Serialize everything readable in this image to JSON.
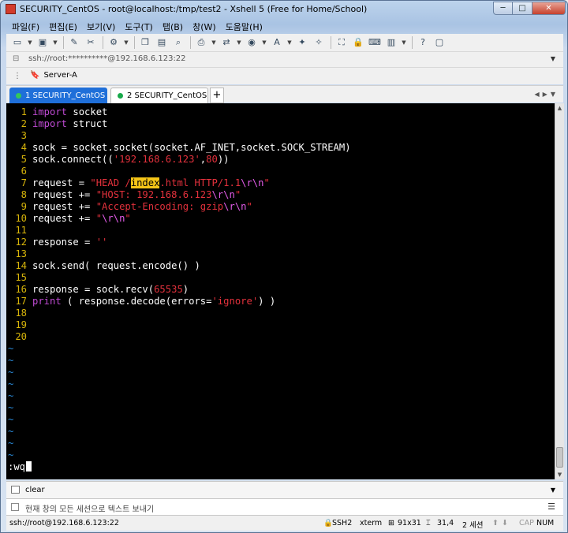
{
  "window": {
    "title": "SECURITY_CentOS - root@localhost:/tmp/test2 - Xshell 5 (Free for Home/School)",
    "minimize": "─",
    "maximize": "□",
    "close": "✕"
  },
  "menu": [
    "파일(F)",
    "편집(E)",
    "보기(V)",
    "도구(T)",
    "탭(B)",
    "창(W)",
    "도움말(H)"
  ],
  "toolbar_icons": [
    "new-session-icon",
    "open-folder-icon",
    "reconnect-icon",
    "disconnect-icon",
    "properties-icon",
    "copy-icon",
    "paste-icon",
    "find-icon",
    "print-icon",
    "transfer-icon",
    "globe-icon",
    "font-icon",
    "xftp-icon",
    "xmanager-icon",
    "fullscreen-icon",
    "lock-icon",
    "keyboard-icon",
    "script-icon",
    "help-icon",
    "chat-icon"
  ],
  "address": {
    "value": "ssh://root:**********@192.168.6.123:22"
  },
  "links": {
    "server": "Server-A"
  },
  "tabs": [
    {
      "label": "1 SECURITY_CentOS",
      "active": true
    },
    {
      "label": "2 SECURITY_CentOS",
      "active": false
    }
  ],
  "tab_add": "+",
  "terminal": {
    "lines": [
      {
        "n": "1",
        "segments": [
          {
            "t": "import",
            "c": "kw"
          },
          {
            "t": " socket",
            "c": ""
          }
        ]
      },
      {
        "n": "2",
        "segments": [
          {
            "t": "import",
            "c": "kw"
          },
          {
            "t": " struct",
            "c": ""
          }
        ]
      },
      {
        "n": "3",
        "segments": []
      },
      {
        "n": "4",
        "segments": [
          {
            "t": "sock = socket.socket(socket.AF_INET,socket.SOCK_STREAM)",
            "c": ""
          }
        ]
      },
      {
        "n": "5",
        "segments": [
          {
            "t": "sock.connect((",
            "c": ""
          },
          {
            "t": "'192.168.6.123'",
            "c": "str"
          },
          {
            "t": ",",
            "c": ""
          },
          {
            "t": "80",
            "c": "str"
          },
          {
            "t": "))",
            "c": ""
          }
        ]
      },
      {
        "n": "6",
        "segments": []
      },
      {
        "n": "7",
        "segments": [
          {
            "t": "request = ",
            "c": ""
          },
          {
            "t": "\"HEAD /",
            "c": "str"
          },
          {
            "t": "index",
            "c": "hl"
          },
          {
            "t": ".html HTTP/1.1",
            "c": "str"
          },
          {
            "t": "\\r\\n",
            "c": "esc"
          },
          {
            "t": "\"",
            "c": "str"
          }
        ]
      },
      {
        "n": "8",
        "segments": [
          {
            "t": "request += ",
            "c": ""
          },
          {
            "t": "\"HOST: 192.168.6.123",
            "c": "str"
          },
          {
            "t": "\\r\\n",
            "c": "esc"
          },
          {
            "t": "\"",
            "c": "str"
          }
        ]
      },
      {
        "n": "9",
        "segments": [
          {
            "t": "request += ",
            "c": ""
          },
          {
            "t": "\"Accept-Encoding: gzip",
            "c": "str"
          },
          {
            "t": "\\r\\n",
            "c": "esc"
          },
          {
            "t": "\"",
            "c": "str"
          }
        ]
      },
      {
        "n": "10",
        "segments": [
          {
            "t": "request += ",
            "c": ""
          },
          {
            "t": "\"",
            "c": "str"
          },
          {
            "t": "\\r\\n",
            "c": "esc"
          },
          {
            "t": "\"",
            "c": "str"
          }
        ]
      },
      {
        "n": "11",
        "segments": []
      },
      {
        "n": "12",
        "segments": [
          {
            "t": "response = ",
            "c": ""
          },
          {
            "t": "''",
            "c": "str"
          }
        ]
      },
      {
        "n": "13",
        "segments": []
      },
      {
        "n": "14",
        "segments": [
          {
            "t": "sock.send( request.encode() )",
            "c": ""
          }
        ]
      },
      {
        "n": "15",
        "segments": []
      },
      {
        "n": "16",
        "segments": [
          {
            "t": "response = sock.recv(",
            "c": ""
          },
          {
            "t": "65535",
            "c": "str"
          },
          {
            "t": ")",
            "c": ""
          }
        ]
      },
      {
        "n": "17",
        "segments": [
          {
            "t": "print",
            "c": "kw"
          },
          {
            "t": " ( response.decode(errors=",
            "c": ""
          },
          {
            "t": "'ignore'",
            "c": "str"
          },
          {
            "t": ") )",
            "c": ""
          }
        ]
      },
      {
        "n": "18",
        "segments": []
      },
      {
        "n": "19",
        "segments": []
      },
      {
        "n": "20",
        "segments": []
      }
    ],
    "tilde_count": 10,
    "tilde": "~",
    "command": ":wq"
  },
  "compose": {
    "value": "clear"
  },
  "send": {
    "placeholder": "현재 창의 모든 세션으로 텍스트 보내기"
  },
  "status": {
    "connection": "ssh://root@192.168.6.123:22",
    "protocol": "SSH2",
    "terminal_type": "xterm",
    "size": "91x31",
    "cursor_pos": "31,4",
    "sessions": "2 세션",
    "cap": "CAP",
    "num": "NUM"
  }
}
